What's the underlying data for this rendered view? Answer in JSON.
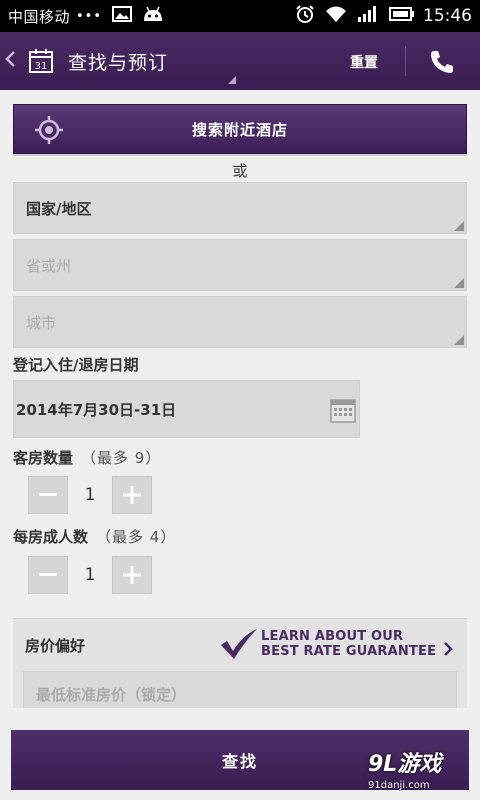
{
  "status_bar": {
    "carrier": "中国移动",
    "dots": "•••",
    "time": "15:46"
  },
  "header": {
    "back_icon": "chevron-left-icon",
    "title": "查找与预订",
    "reset_label": "重置",
    "calendar_day": "31"
  },
  "nearby": {
    "label": "搜索附近酒店"
  },
  "or_text": "或",
  "location": {
    "country": "国家/地区",
    "province_placeholder": "省或州",
    "city_placeholder": "城市"
  },
  "dates": {
    "label": "登记入住/退房日期",
    "value": "2014年7月30日-31日"
  },
  "rooms": {
    "label": "客房数量",
    "hint": "（最多 9）",
    "value": "1"
  },
  "adults": {
    "label": "每房成人数",
    "hint": "（最多 4）",
    "value": "1"
  },
  "price": {
    "label": "房价偏好",
    "learn_line1": "LEARN ABOUT OUR",
    "learn_line2": "BEST RATE GUARANTEE",
    "min_rate_placeholder": "最低标准房价（锁定）"
  },
  "search_button": "查找",
  "watermark": {
    "logo": "9L游戏",
    "url": "91danji.com"
  },
  "colors": {
    "brand_purple": "#4a2a63",
    "background": "#eeeeee",
    "field": "#d9d9d9"
  }
}
